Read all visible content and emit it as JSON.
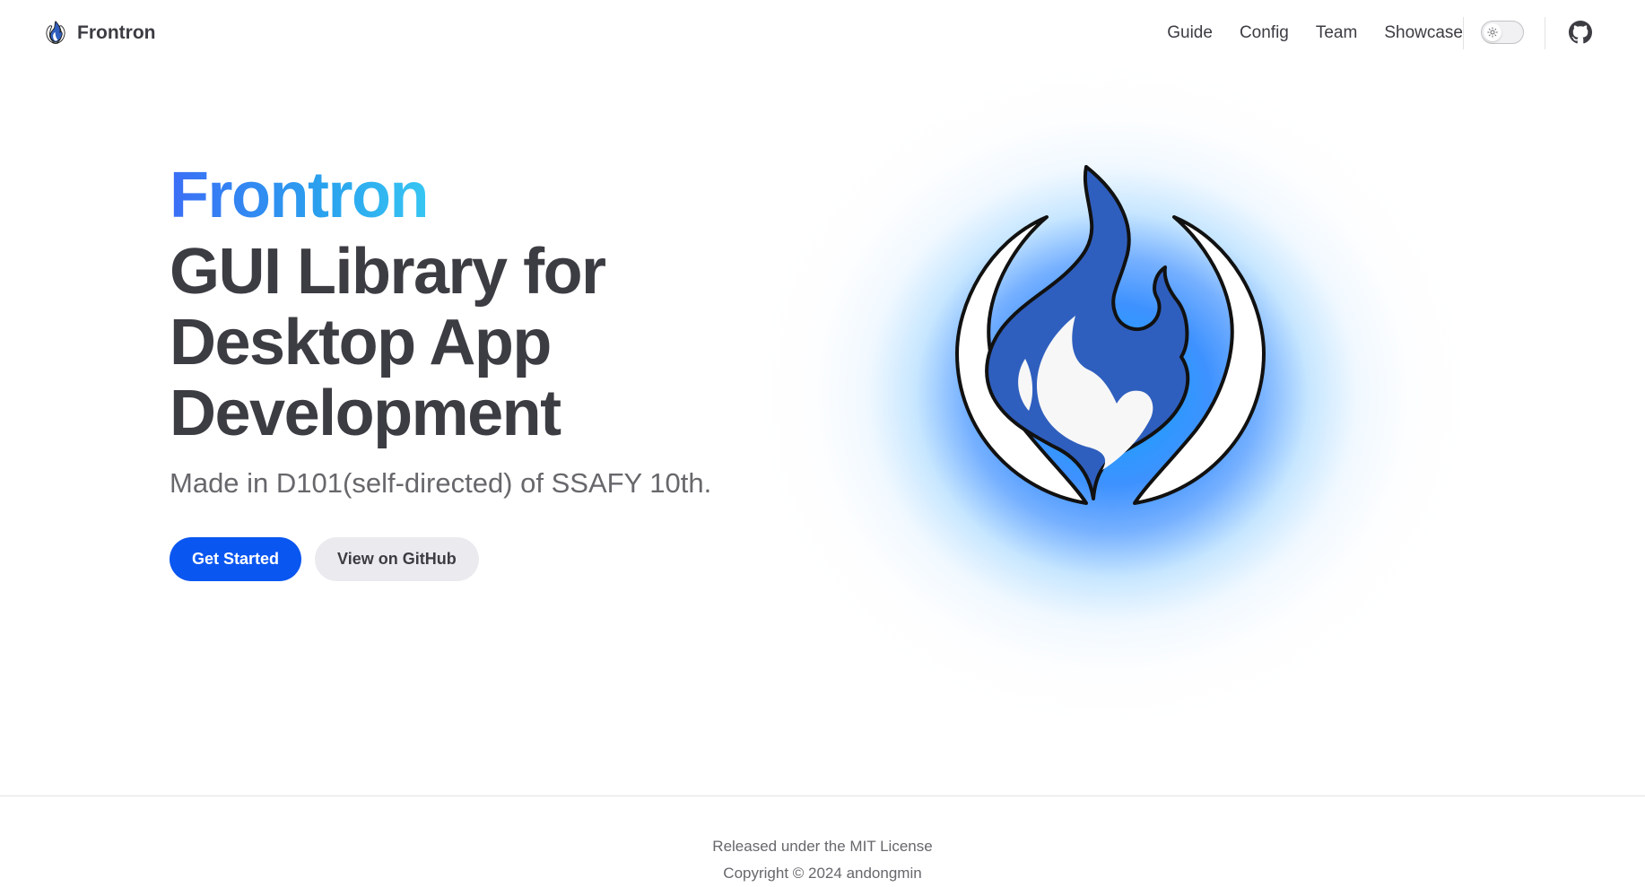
{
  "nav": {
    "brand": "Frontron",
    "links": [
      "Guide",
      "Config",
      "Team",
      "Showcase"
    ],
    "theme_toggle_icon": "sun-icon",
    "github_icon": "github-icon"
  },
  "hero": {
    "name": "Frontron",
    "tagline": "GUI Library for Desktop App Development",
    "subtitle": "Made in D101(self-directed) of SSAFY 10th.",
    "actions": {
      "primary": "Get Started",
      "secondary": "View on GitHub"
    },
    "image_icon": "frontron-flame-logo",
    "colors": {
      "brand_gradient_start": "#3b6ef6",
      "brand_gradient_end": "#37c6f3",
      "primary_button": "#0a56f0",
      "flame": "#2f5fbe"
    }
  },
  "footer": {
    "message": "Released under the MIT License",
    "copyright": "Copyright © 2024 andongmin"
  }
}
